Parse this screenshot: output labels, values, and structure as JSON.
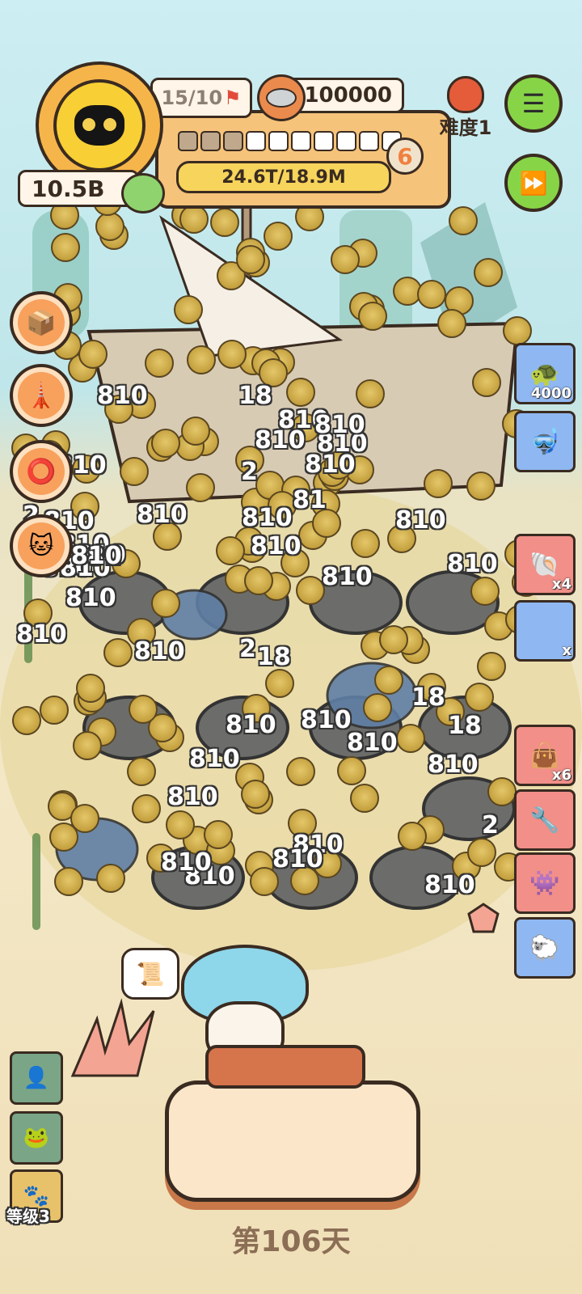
{
  "hud": {
    "energy_text": "15/10",
    "currency_value": "100000",
    "balance": "10.5B",
    "progress_text": "24.6T/18.9M",
    "level_number": "6",
    "slots_total": 10,
    "slots_filled": 3,
    "difficulty_label": "难度1"
  },
  "right_cards": [
    {
      "name": "turtle-shell-card",
      "count": "4000",
      "color": "blue"
    },
    {
      "name": "scuba-card",
      "count": "",
      "color": "blue"
    },
    {
      "name": "shell-card",
      "count": "x4",
      "color": "red"
    },
    {
      "name": "unknown-card",
      "count": "x",
      "color": "blue"
    },
    {
      "name": "bag-card",
      "count": "x6",
      "color": "red"
    },
    {
      "name": "tools-card",
      "count": "",
      "color": "red"
    },
    {
      "name": "monster-card",
      "count": "",
      "color": "red"
    },
    {
      "name": "sheep-card",
      "count": "",
      "color": "blue"
    }
  ],
  "left_circles": [
    "box-icon",
    "cat-tree-icon",
    "collar-icon",
    "lucky-cat-icon"
  ],
  "float_values": [
    "810",
    "18",
    "2",
    "81"
  ],
  "bottom_left": {
    "level_label": "等级3"
  },
  "footer": {
    "day_label": "第106天"
  },
  "icons": {
    "menu": "menu-icon",
    "fast_forward": "fast-forward-icon",
    "flag": "flag-icon",
    "can": "cat-food-can-icon"
  },
  "colors": {
    "accent_green": "#88d447",
    "coin_yellow": "#f8cf34",
    "panel_orange": "#f6c37a",
    "level_orange": "#f08040"
  }
}
